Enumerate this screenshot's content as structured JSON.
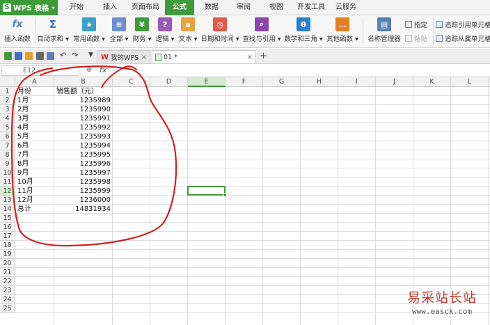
{
  "app": {
    "name": "WPS 表格",
    "logo_glyph": "S"
  },
  "menu_tabs": [
    {
      "label": "开始",
      "active": false
    },
    {
      "label": "插入",
      "active": false
    },
    {
      "label": "页面布局",
      "active": false
    },
    {
      "label": "公式",
      "active": true
    },
    {
      "label": "数据",
      "active": false
    },
    {
      "label": "审阅",
      "active": false
    },
    {
      "label": "视图",
      "active": false
    },
    {
      "label": "开发工具",
      "active": false
    },
    {
      "label": "云服务",
      "active": false
    }
  ],
  "ribbon": {
    "insert_function": {
      "label": "插入函数",
      "glyph": "fx",
      "icon": "function-icon"
    },
    "autosum": {
      "label": "自动求和 ▾",
      "glyph": "Σ",
      "icon": "sigma-icon"
    },
    "common": {
      "label": "常用函数 ▾",
      "glyph": "★",
      "icon": "star-function-icon"
    },
    "all": {
      "label": "全部 ▾",
      "glyph": "≡",
      "icon": "list-function-icon"
    },
    "finance": {
      "label": "财务 ▾",
      "glyph": "¥",
      "icon": "finance-icon"
    },
    "logic": {
      "label": "逻辑 ▾",
      "glyph": "?",
      "icon": "logic-icon"
    },
    "text": {
      "label": "文本 ▾",
      "glyph": "a",
      "icon": "text-icon"
    },
    "datetime": {
      "label": "日期和时间 ▾",
      "glyph": "◷",
      "icon": "clock-icon"
    },
    "lookup": {
      "label": "查找与引用 ▾",
      "glyph": "⌕",
      "icon": "lookup-icon"
    },
    "math": {
      "label": "数学和三角 ▾",
      "glyph": "θ",
      "icon": "math-icon"
    },
    "other": {
      "label": "其他函数 ▾",
      "glyph": "…",
      "icon": "other-function-icon"
    },
    "name_manager": {
      "label": "名称管理器",
      "glyph": "▤",
      "icon": "name-manager-icon"
    },
    "specify": {
      "label": "指定"
    },
    "paste": {
      "label": "粘贴"
    },
    "trace_precedents": {
      "label": "追踪引用单元格"
    },
    "trace_dependents": {
      "label": "追踪从属单元格"
    },
    "colors": {
      "insert_function": "#5b7fb8",
      "autosum": "#3a6fc4",
      "common": "#3aa0c8",
      "all": "#6b8fd0",
      "finance": "#3e9b3a",
      "logic": "#9b59b6",
      "text": "#e6a23c",
      "datetime": "#e05a47",
      "lookup": "#8e44ad",
      "math": "#2f7fd1",
      "other": "#e67e22",
      "name_manager": "#5b7fb8"
    }
  },
  "quickbar": {
    "icons": [
      "logo-menu-icon",
      "save-icon",
      "export-icon",
      "print-icon",
      "print-preview-icon",
      "undo-icon",
      "redo-icon",
      "more-icon"
    ]
  },
  "doc_tabs": [
    {
      "label": "我的WPS",
      "logo": "W",
      "close": "×",
      "active": false
    },
    {
      "label": "01 *",
      "close": "×",
      "active": true
    }
  ],
  "new_tab": "+",
  "formula_bar": {
    "name_box": "E12",
    "zoom_glyph": "⊕",
    "fx": "fx",
    "value": ""
  },
  "columns": [
    "A",
    "B",
    "C",
    "D",
    "E",
    "F",
    "G",
    "H",
    "I",
    "J",
    "K",
    "L"
  ],
  "selected_column": "E",
  "selected_row": 12,
  "rows": [
    "1",
    "2",
    "3",
    "4",
    "5",
    "6",
    "7",
    "8",
    "9",
    "10",
    "11",
    "12",
    "13",
    "14",
    "15",
    "16",
    "17",
    "18",
    "19",
    "20",
    "21",
    "22",
    "23",
    "24",
    "25"
  ],
  "sheet": {
    "header": {
      "a": "月份",
      "b": "销售额（元）"
    },
    "data": [
      {
        "a": "1月",
        "b": "1235989"
      },
      {
        "a": "2月",
        "b": "1235990"
      },
      {
        "a": "3月",
        "b": "1235991"
      },
      {
        "a": "4月",
        "b": "1235992"
      },
      {
        "a": "5月",
        "b": "1235993"
      },
      {
        "a": "6月",
        "b": "1235994"
      },
      {
        "a": "7月",
        "b": "1235995"
      },
      {
        "a": "8月",
        "b": "1235996"
      },
      {
        "a": "9月",
        "b": "1235997"
      },
      {
        "a": "10月",
        "b": "1235998"
      },
      {
        "a": "11月",
        "b": "1235999"
      },
      {
        "a": "12月",
        "b": "1236000"
      }
    ],
    "total": {
      "a": "总计",
      "b": "14831934"
    }
  },
  "annotation_color": "#d42020",
  "watermark": {
    "title": "易采站长站",
    "url": "www.easck.com"
  }
}
